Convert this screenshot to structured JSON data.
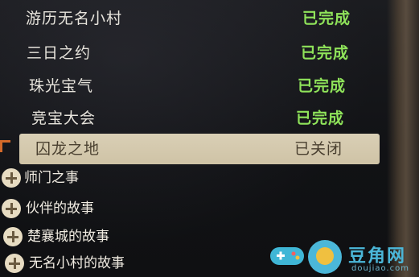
{
  "quests": [
    {
      "name": "游历无名小村",
      "status": "已完成",
      "selected": false
    },
    {
      "name": "三日之约",
      "status": "已完成",
      "selected": false
    },
    {
      "name": "珠光宝气",
      "status": "已完成",
      "selected": false
    },
    {
      "name": "竞宝大会",
      "status": "已完成",
      "selected": false
    },
    {
      "name": "囚龙之地",
      "status": "已关闭",
      "selected": true
    }
  ],
  "categories": [
    {
      "label": "师门之事",
      "icon": "plus-icon"
    },
    {
      "label": "伙伴的故事",
      "icon": "plus-icon"
    },
    {
      "label": "楚襄城的故事",
      "icon": "plus-icon"
    },
    {
      "label": "无名小村的故事",
      "icon": "plus-icon"
    }
  ],
  "watermark": {
    "text": "豆角网",
    "subtext": "doujiao.com",
    "icon": "gamepad-icon"
  },
  "colors": {
    "completed_status": "#8fe35a",
    "selected_row_bg": "#d9cfb5",
    "text_light": "#e7e4dc"
  }
}
